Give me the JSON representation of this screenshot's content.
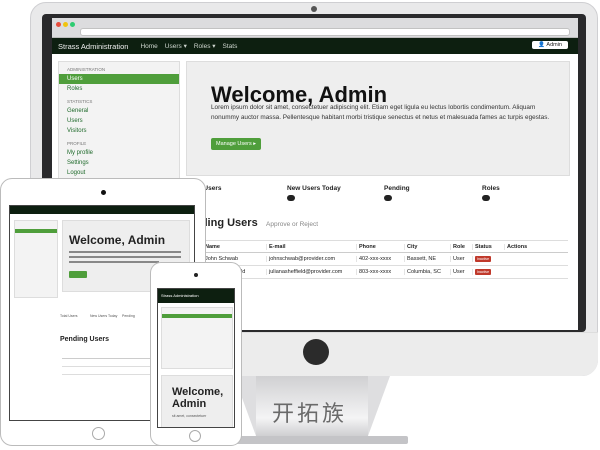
{
  "app": {
    "brand": "Strass Administration"
  },
  "nav": {
    "home": "Home",
    "users": "Users ▾",
    "roles": "Roles ▾",
    "stats": "Stats",
    "admin": "Admin"
  },
  "sidebar": {
    "administration": "ADMINISTRATION",
    "users": "Users",
    "roles": "Roles",
    "statistics": "STATISTICS",
    "general": "General",
    "stat_users": "Users",
    "visitors": "Visitors",
    "profile": "PROFILE",
    "my_profile": "My profile",
    "settings": "Settings",
    "logout": "Logout"
  },
  "jumbotron": {
    "title": "Welcome, Admin",
    "text": "Lorem ipsum dolor sit amet, consectetuer adipiscing elit. Etiam eget ligula eu lectus lobortis condimentum. Aliquam nonummy auctor massa. Pellentesque habitant morbi tristique senectus et netus et malesuada fames ac turpis egestas.",
    "button": "Manage Users ▸"
  },
  "stats": {
    "total": "tal Users",
    "new_today": "New Users Today",
    "pending": "Pending",
    "roles": "Roles",
    "b_total": "4",
    "b_new": "0",
    "b_pending": "2",
    "b_roles": "3"
  },
  "pending": {
    "title": "ending Users",
    "subtitle": "Approve or Reject",
    "headers": [
      "#",
      "Name",
      "E-mail",
      "Phone",
      "City",
      "Role",
      "Status",
      "Actions"
    ],
    "rows": [
      [
        "",
        "John Schwab",
        "johnschwab@provider.com",
        "402-xxx-xxxx",
        "Bassett, NE",
        "User",
        "Inactive",
        ""
      ],
      [
        "",
        "Juliana Sheffield",
        "julianasheffield@provider.com",
        "803-xxx-xxxx",
        "Columbia, SC",
        "User",
        "Inactive",
        ""
      ]
    ]
  },
  "tablet": {
    "title": "Welcome, Admin",
    "users": "Total Users",
    "new": "New Users Today",
    "pending": "Pending",
    "pending_title": "Pending Users",
    "approve": "Approve or Reject"
  },
  "phone": {
    "brand": "Strass Administration",
    "title": "Welcome, Admin",
    "text": "sit amet, consectetuer"
  },
  "watermark": "开拓族"
}
